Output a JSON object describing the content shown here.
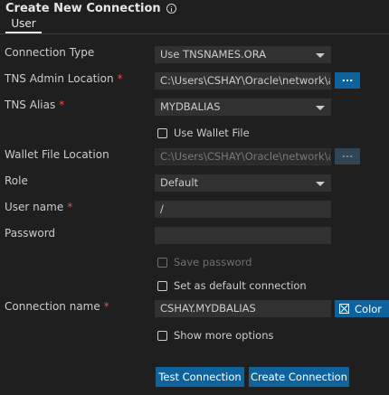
{
  "header": {
    "title": "Create New Connection",
    "info_icon": "info-icon"
  },
  "tabs": [
    {
      "label": "User",
      "active": true
    }
  ],
  "form": {
    "connection_type": {
      "label": "Connection Type",
      "value": "Use TNSNAMES.ORA"
    },
    "tns_admin_location": {
      "label": "TNS Admin Location",
      "required_mark": "*",
      "value": "C:\\Users\\CSHAY\\Oracle\\network\\admin",
      "browse_label": "..."
    },
    "tns_alias": {
      "label": "TNS Alias",
      "required_mark": "*",
      "value": "MYDBALIAS"
    },
    "use_wallet_file": {
      "label": "Use Wallet File",
      "checked": false
    },
    "wallet_file_location": {
      "label": "Wallet File Location",
      "value": "C:\\Users\\CSHAY\\Oracle\\network\\admin\\mya",
      "browse_label": "..."
    },
    "role": {
      "label": "Role",
      "value": "Default"
    },
    "user_name": {
      "label": "User name",
      "required_mark": "*",
      "value": "/"
    },
    "password": {
      "label": "Password",
      "value": ""
    },
    "save_password": {
      "label": "Save password",
      "checked": false,
      "disabled": true
    },
    "set_default": {
      "label": "Set as default connection",
      "checked": false
    },
    "connection_name": {
      "label": "Connection name",
      "required_mark": "*",
      "value": "CSHAY.MYDBALIAS",
      "color_label": "Color"
    },
    "show_more_options": {
      "label": "Show more options",
      "checked": false
    }
  },
  "actions": {
    "test_label": "Test Connection",
    "create_label": "Create Connection"
  },
  "colors": {
    "background": "#1f1f1f",
    "accent": "#0e639c",
    "required": "#f14c4c",
    "input_bg": "#313131"
  }
}
